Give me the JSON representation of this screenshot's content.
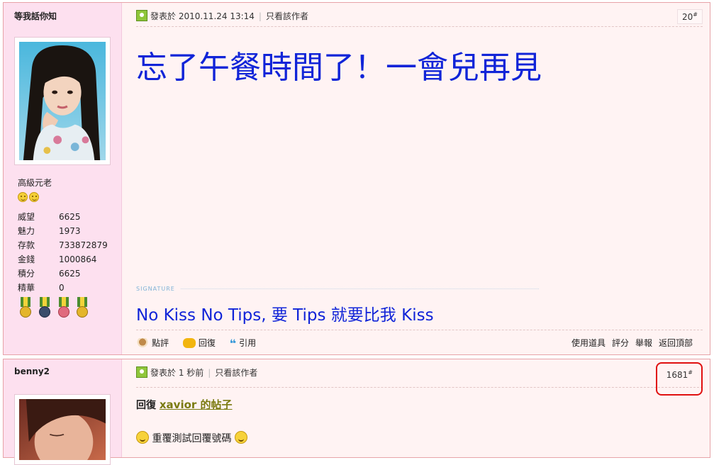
{
  "post1": {
    "author": "等我話你知",
    "rank": "高級元老",
    "stats": [
      {
        "label": "威望",
        "value": "6625"
      },
      {
        "label": "魅力",
        "value": "1973"
      },
      {
        "label": "存款",
        "value": "733872879"
      },
      {
        "label": "金錢",
        "value": "1000864"
      },
      {
        "label": "積分",
        "value": "6625"
      },
      {
        "label": "精華",
        "value": "0"
      }
    ],
    "posted": "發表於 2010.11.24 13:14",
    "only_author": "只看該作者",
    "floor": "20",
    "floor_sup": "#",
    "message": "忘了午餐時間了！一會兒再見",
    "signature_label": "SIGNATURE",
    "signature": "No Kiss No Tips, 要 Tips 就要比我 Kiss",
    "actions": {
      "rate_comment": "點評",
      "reply": "回復",
      "quote": "引用"
    },
    "tools": {
      "use_item": "使用道具",
      "rate": "評分",
      "report": "舉報",
      "top": "返回頂部"
    }
  },
  "post2": {
    "author": "benny2",
    "posted": "發表於 1 秒前",
    "only_author": "只看該作者",
    "floor": "1681",
    "floor_sup": "#",
    "reply_prefix": "回復",
    "reply_link": "xavior 的帖子",
    "body": "重覆測試回覆號碼"
  },
  "colors": {
    "message_blue": "#1024d8",
    "sidebar_pink": "#fde0ef",
    "post_bg": "#fff3f3",
    "highlight_red": "#e01010"
  }
}
